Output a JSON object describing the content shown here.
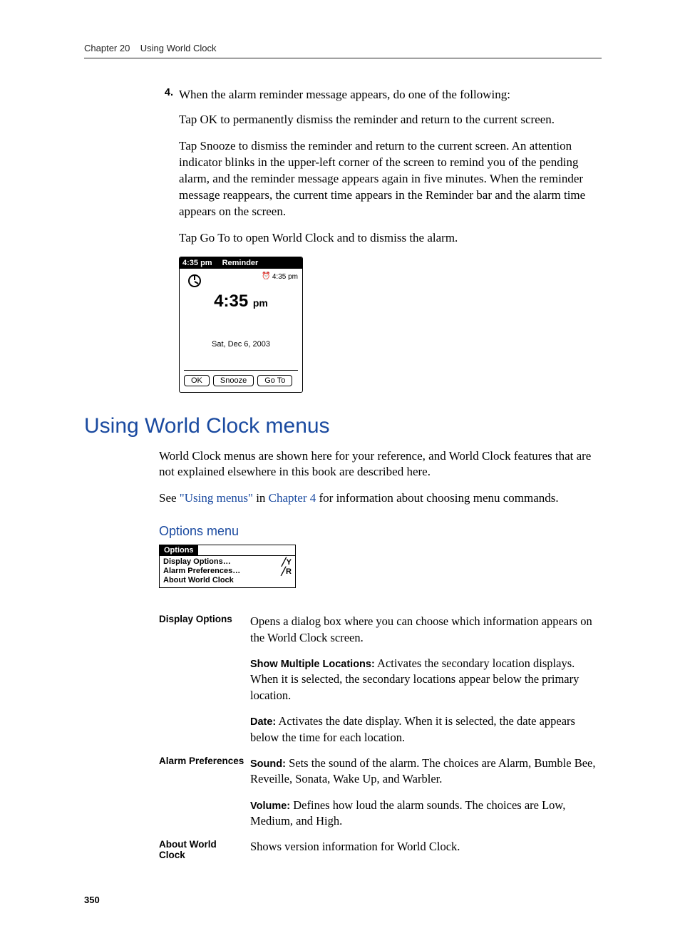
{
  "header": {
    "chapter": "Chapter 20",
    "title": "Using World Clock"
  },
  "step4": {
    "num": "4.",
    "text": "When the alarm reminder message appears, do one of the following:"
  },
  "p_ok": "Tap OK to permanently dismiss the reminder and return to the current screen.",
  "p_snooze": "Tap Snooze to dismiss the reminder and return to the current screen. An attention indicator blinks in the upper-left corner of the screen to remind you of the pending alarm, and the reminder message appears again in five minutes. When the reminder message reappears, the current time appears in the Reminder bar and the alarm time appears on the screen.",
  "p_goto": "Tap Go To to open World Clock and to dismiss the alarm.",
  "reminder_ss": {
    "bar_time": "4:35 pm",
    "bar_title": "Reminder",
    "alarm_glyph": "⏰",
    "alarm_time": "4:35 pm",
    "big_time": "4:35",
    "big_time_suffix": "pm",
    "date": "Sat, Dec 6, 2003",
    "btn_ok": "OK",
    "btn_snooze": "Snooze",
    "btn_goto": "Go To"
  },
  "h1": "Using World Clock menus",
  "p_intro": "World Clock menus are shown here for your reference, and World Clock features that are not explained elsewhere in this book are described here.",
  "p_see_prefix": "See ",
  "p_see_link1": "\"Using menus\"",
  "p_see_mid": " in ",
  "p_see_link2": "Chapter 4",
  "p_see_suffix": " for information about choosing menu commands.",
  "h2": "Options menu",
  "menu_ss": {
    "title": "Options",
    "items": [
      {
        "label": "Display Options…",
        "shortcut": "╱Y"
      },
      {
        "label": "Alarm Preferences…",
        "shortcut": "╱R"
      },
      {
        "label": "About World Clock",
        "shortcut": ""
      }
    ]
  },
  "defs": {
    "display_options": {
      "term": "Display Options",
      "d1": "Opens a dialog box where you can choose which information appears on the World Clock screen.",
      "d2_b": "Show Multiple Locations:",
      "d2": " Activates the secondary location displays. When it is selected, the secondary locations appear below the primary location.",
      "d3_b": "Date:",
      "d3": " Activates the date display. When it is selected, the date appears below the time for each location."
    },
    "alarm_prefs": {
      "term": "Alarm Preferences",
      "d1_b": "Sound:",
      "d1": " Sets the sound of the alarm. The choices are Alarm, Bumble Bee, Reveille, Sonata, Wake Up, and Warbler.",
      "d2_b": "Volume:",
      "d2": " Defines how loud the alarm sounds. The choices are Low, Medium, and High."
    },
    "about": {
      "term": "About World Clock",
      "d1": "Shows version information for World Clock."
    }
  },
  "page_num": "350"
}
